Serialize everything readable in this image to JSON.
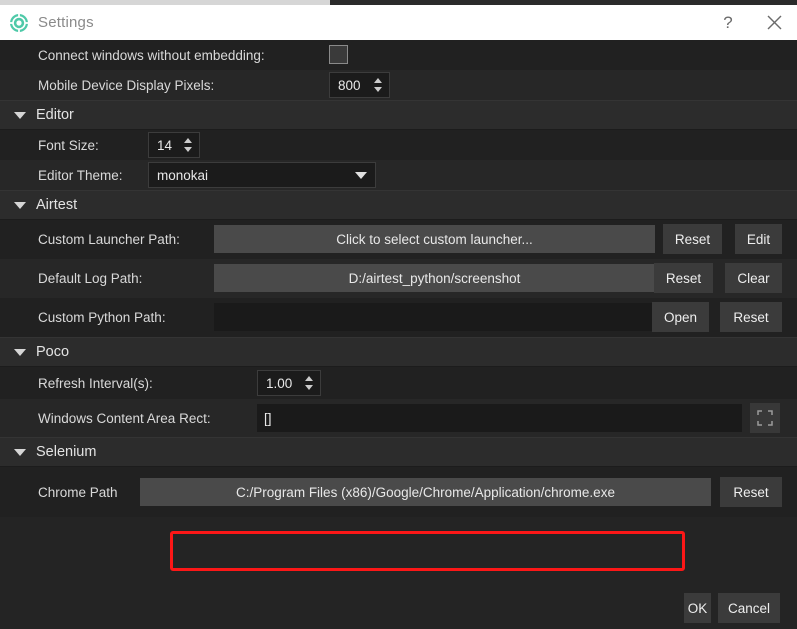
{
  "window": {
    "title": "Settings",
    "icon": "gear-icon",
    "help_label": "?",
    "close_label": "✕",
    "accent_color": "#4ec9a8",
    "background_color": "#242424",
    "highlight_color": "#fc1717"
  },
  "general": {
    "connect_windows": {
      "label": "Connect windows without embedding:",
      "checked": false
    },
    "mobile_pixels": {
      "label": "Mobile Device Display Pixels:",
      "value": "800"
    }
  },
  "sections": {
    "editor": {
      "title": "Editor",
      "expanded": true,
      "font_size": {
        "label": "Font Size:",
        "value": "14"
      },
      "editor_theme": {
        "label": "Editor Theme:",
        "value": "monokai",
        "options": [
          "monokai"
        ]
      }
    },
    "airtest": {
      "title": "Airtest",
      "expanded": true,
      "custom_launcher": {
        "label": "Custom Launcher Path:",
        "value": "",
        "placeholder": "Click to select custom launcher...",
        "buttons": [
          "Reset",
          "Edit"
        ]
      },
      "default_log": {
        "label": "Default Log Path:",
        "value": "D:/airtest_python/screenshot",
        "buttons": [
          "Reset",
          "Clear"
        ]
      },
      "custom_python": {
        "label": "Custom Python Path:",
        "value": "",
        "buttons": [
          "Open",
          "Reset"
        ]
      }
    },
    "poco": {
      "title": "Poco",
      "expanded": true,
      "refresh_interval": {
        "label": "Refresh Interval(s):",
        "value": "1.00"
      },
      "content_rect": {
        "label": "Windows Content Area Rect:",
        "value": "[]",
        "picker_icon": "select-area-icon"
      }
    },
    "selenium": {
      "title": "Selenium",
      "expanded": true,
      "chrome_path": {
        "label": "Chrome Path",
        "value": "C:/Program Files (x86)/Google/Chrome/Application/chrome.exe",
        "highlighted": true,
        "buttons": [
          "Reset"
        ]
      }
    }
  },
  "footer": {
    "ok_label": "OK",
    "cancel_label": "Cancel"
  }
}
